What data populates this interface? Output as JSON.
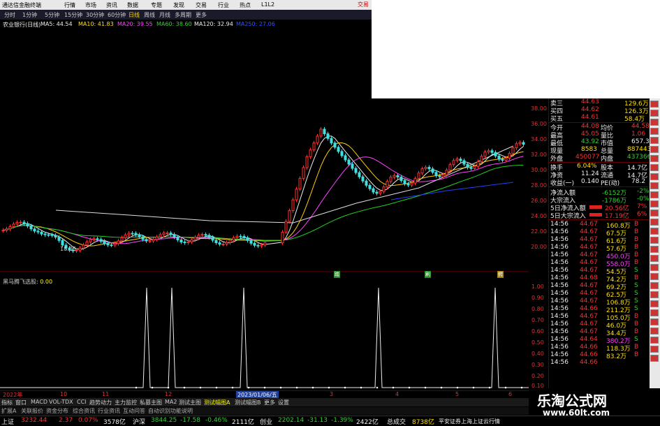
{
  "titlebar": {
    "app_title": "通达信金融终端",
    "menus": [
      "行情",
      "市场",
      "资讯",
      "数据",
      "专题",
      "发现",
      "交易",
      "行业",
      "热点",
      "L1L2"
    ],
    "right_label": "交易"
  },
  "periods": [
    "分时",
    "1分钟",
    "5分钟",
    "15分钟",
    "30分钟",
    "60分钟",
    "日线",
    "周线",
    "月线",
    "多周期",
    "更多"
  ],
  "selected_period": "日线",
  "ma_line": {
    "stock": "农业银行(日线)",
    "ma5": "MA5: 44.54",
    "ma10": "MA10: 41.83",
    "ma20": "MA20: 39.55",
    "ma60": "MA60: 38.60",
    "ma120": "MA120: 32.94",
    "ma250": "MA250: 27.06"
  },
  "price_scale": [
    "38.00",
    "36.00",
    "34.00",
    "32.00",
    "30.00",
    "28.00",
    "26.00",
    "24.00",
    "22.00",
    "20.00"
  ],
  "low_marker": "18.05",
  "signal_panel": {
    "title": "黑马腾飞选股",
    "value": ": 0.00",
    "scale": [
      "1.00",
      "0.90",
      "0.80",
      "0.70",
      "0.60",
      "0.50",
      "0.40",
      "0.30",
      "0.20",
      "0.10"
    ]
  },
  "signal_marks": [
    "踏",
    "刷",
    "鳄"
  ],
  "dates": [
    "2022年",
    "10",
    "11",
    "12",
    "2023/01/06/五",
    "3",
    "4",
    "5",
    "6"
  ],
  "tabs": [
    "指标",
    "窗口",
    "MACD",
    "VOL-TDX",
    "CCI",
    "趋势动力",
    "主力监控",
    "私募主图",
    "MA2",
    "测试主图",
    "测试幅图A",
    "测试幅图B",
    "更多",
    "设置"
  ],
  "subtabs": [
    "扩展A",
    "关联报价",
    "资金分布",
    "综合资讯",
    "行业资讯",
    "互动问答",
    "自动识别功能说明"
  ],
  "quote": {
    "asks": [
      {
        "label": "卖三",
        "price": "44.63",
        "vol": "129.6万"
      },
      {
        "label": "买四",
        "price": "44.62",
        "vol": "126.3万"
      },
      {
        "label": "买五",
        "price": "44.61",
        "vol": "58.4万"
      }
    ],
    "stats": [
      {
        "l1": "今开",
        "v1": "44.08",
        "l2": "均价",
        "v2": "44.58"
      },
      {
        "l1": "最高",
        "v1": "45.05",
        "l2": "量比",
        "v2": "1.06"
      },
      {
        "l1": "最低",
        "v1": "43.92",
        "l2": "市值",
        "v2": "657.3"
      },
      {
        "l1": "现量",
        "v1": "8583",
        "l2": "总量",
        "v2": "887443"
      },
      {
        "l1": "外盘",
        "v1": "450077",
        "l2": "内盘",
        "v2": "437366"
      },
      {
        "l1": "换手",
        "v1": "6.04%",
        "l2": "股本",
        "v2": "14.7亿"
      },
      {
        "l1": "净资",
        "v1": "11.24",
        "l2": "流通",
        "v2": "14.7亿"
      },
      {
        "l1": "收益(一)",
        "v1": "0.140",
        "l2": "PE(动)",
        "v2": "78.2"
      }
    ],
    "flows": [
      {
        "label": "净流入额",
        "value": "-6152万",
        "pct": "-2%"
      },
      {
        "label": "大宗流入",
        "value": "-1786万",
        "pct": "-0%"
      },
      {
        "label": "5日净流入额",
        "value": "20.56亿",
        "pct": "7%"
      },
      {
        "label": "5日大宗流入",
        "value": "17.19亿",
        "pct": "6%"
      }
    ],
    "ticks": [
      {
        "t": "14:56",
        "p": "44.67",
        "v": "160.8万",
        "s": "B"
      },
      {
        "t": "14:56",
        "p": "44.67",
        "v": "67.5万",
        "s": "B"
      },
      {
        "t": "14:56",
        "p": "44.67",
        "v": "61.6万",
        "s": "B"
      },
      {
        "t": "14:56",
        "p": "44.67",
        "v": "57.6万",
        "s": "B"
      },
      {
        "t": "14:56",
        "p": "44.67",
        "v": "450.0万",
        "s": "B"
      },
      {
        "t": "14:56",
        "p": "44.67",
        "v": "558.0万",
        "s": "B"
      },
      {
        "t": "14:56",
        "p": "44.67",
        "v": "54.5万",
        "s": "S"
      },
      {
        "t": "14:56",
        "p": "44.68",
        "v": "74.2万",
        "s": "B"
      },
      {
        "t": "14:56",
        "p": "44.67",
        "v": "69.2万",
        "s": "S"
      },
      {
        "t": "14:56",
        "p": "44.67",
        "v": "62.5万",
        "s": "S"
      },
      {
        "t": "14:56",
        "p": "44.67",
        "v": "106.8万",
        "s": "S"
      },
      {
        "t": "14:56",
        "p": "44.66",
        "v": "211.2万",
        "s": "S"
      },
      {
        "t": "14:56",
        "p": "44.67",
        "v": "105.0万",
        "s": "B"
      },
      {
        "t": "14:56",
        "p": "44.67",
        "v": "46.0万",
        "s": "B"
      },
      {
        "t": "14:56",
        "p": "44.67",
        "v": "34.4万",
        "s": "B"
      },
      {
        "t": "14:56",
        "p": "44.64",
        "v": "380.2万",
        "s": "S"
      },
      {
        "t": "14:56",
        "p": "44.66",
        "v": "118.3万",
        "s": "B"
      },
      {
        "t": "14:56",
        "p": "44.66",
        "v": "83.2万",
        "s": "B"
      },
      {
        "t": "14:56",
        "p": "44.66",
        "v": "",
        "s": ""
      }
    ]
  },
  "ticker": [
    {
      "name": "上证",
      "value": "3232.44",
      "chg": "2.37",
      "pct": "0.07%",
      "amt": "3578亿"
    },
    {
      "name": "沪深",
      "value": "3844.25",
      "chg": "-17.58",
      "pct": "-0.46%",
      "amt": "2111亿"
    },
    {
      "name": "创业",
      "value": "2202.14",
      "chg": "-31.13",
      "pct": "-1.39%",
      "amt": "2422亿"
    }
  ],
  "ticker_extra": {
    "label": "总成交",
    "value": "8738亿",
    "broker": "平安证券上海上证云行情"
  },
  "watermark": {
    "line1": "乐淘公式网",
    "line2": "www.60lt.com"
  }
}
